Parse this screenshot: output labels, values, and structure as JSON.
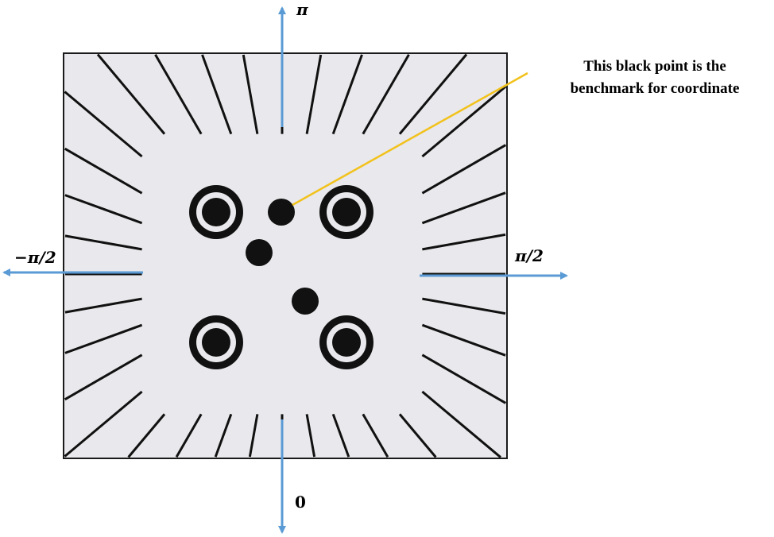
{
  "labels": {
    "top": "π",
    "bottom": "0",
    "left": "−π/2",
    "right": "π/2"
  },
  "annotation": {
    "line1": "This black point is the",
    "line2": "benchmark for coordinate"
  },
  "colors": {
    "axis_arrow": "#5b9bd5",
    "leader_line": "#f2c21b",
    "board": "#e9e8ec",
    "marks": "#111111"
  }
}
